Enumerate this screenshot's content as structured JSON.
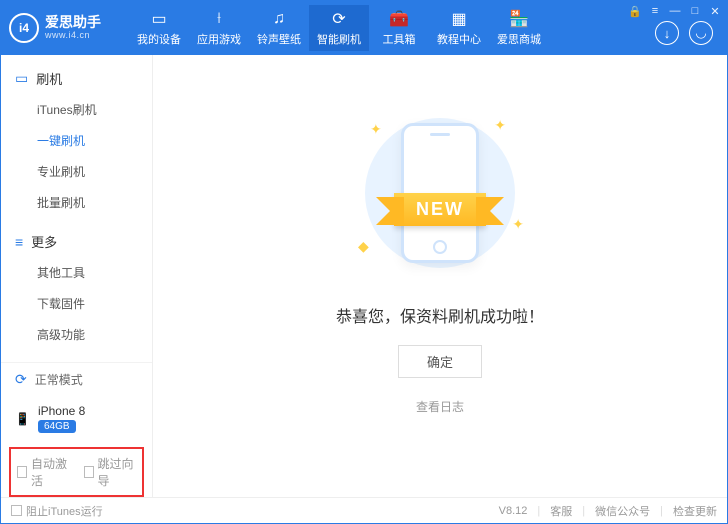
{
  "app": {
    "brand": "爱思助手",
    "subtitle": "www.i4.cn",
    "logo_text": "i4"
  },
  "nav": [
    {
      "icon": "▭",
      "label": "我的设备"
    },
    {
      "icon": "⟊",
      "label": "应用游戏"
    },
    {
      "icon": "♫",
      "label": "铃声壁纸"
    },
    {
      "icon": "⟳",
      "label": "智能刷机",
      "active": true
    },
    {
      "icon": "🧰",
      "label": "工具箱"
    },
    {
      "icon": "▦",
      "label": "教程中心"
    },
    {
      "icon": "🏪",
      "label": "爱思商城"
    }
  ],
  "sidebar": {
    "groups": [
      {
        "icon": "▭",
        "title": "刷机",
        "items": [
          {
            "label": "iTunes刷机"
          },
          {
            "label": "一键刷机",
            "active": true
          },
          {
            "label": "专业刷机"
          },
          {
            "label": "批量刷机"
          }
        ]
      },
      {
        "icon": "≡",
        "title": "更多",
        "items": [
          {
            "label": "其他工具"
          },
          {
            "label": "下载固件"
          },
          {
            "label": "高级功能"
          }
        ]
      }
    ],
    "mode": {
      "label": "正常模式"
    },
    "device": {
      "name": "iPhone 8",
      "storage": "64GB"
    },
    "checkboxes": {
      "auto_activate": "自动激活",
      "skip_guide": "跳过向导"
    }
  },
  "main": {
    "ribbon": "NEW",
    "success": "恭喜您，保资料刷机成功啦！",
    "ok": "确定",
    "view_log": "查看日志"
  },
  "footer": {
    "block_itunes": "阻止iTunes运行",
    "version": "V8.12",
    "support": "客服",
    "wechat": "微信公众号",
    "update": "检查更新"
  }
}
